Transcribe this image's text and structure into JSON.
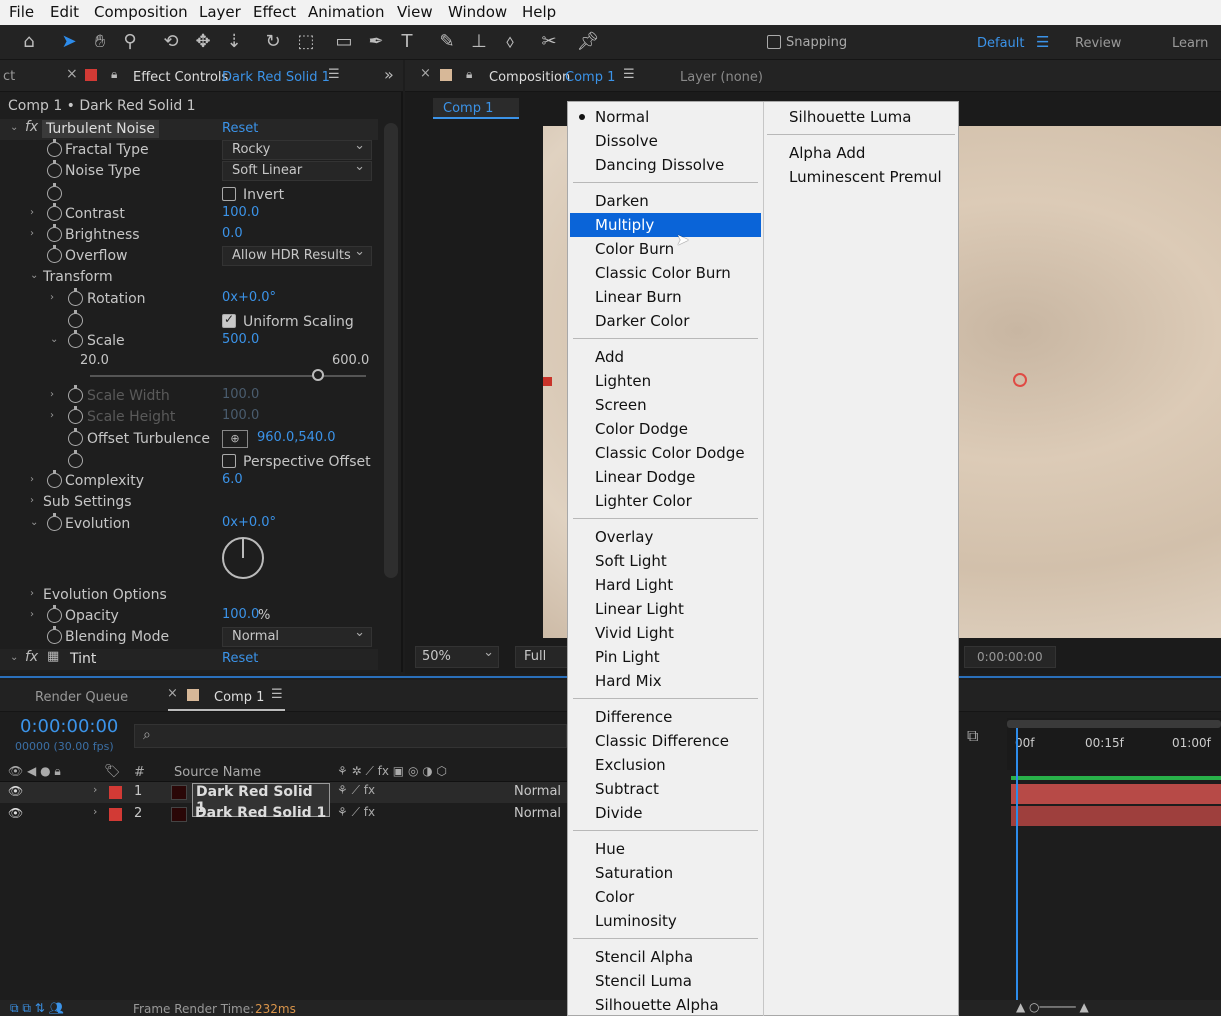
{
  "menubar": [
    "File",
    "Edit",
    "Composition",
    "Layer",
    "Effect",
    "Animation",
    "View",
    "Window",
    "Help"
  ],
  "toolbar": {
    "icons": [
      "home-icon",
      "selection-tool-icon",
      "hand-tool-icon",
      "zoom-tool-icon",
      "orbit-camera-icon",
      "pan-camera-icon",
      "dolly-camera-icon",
      "rotation-tool-icon",
      "pan-behind-icon",
      "rectangle-tool-icon",
      "pen-tool-icon",
      "type-tool-icon",
      "brush-tool-icon",
      "clone-stamp-icon",
      "eraser-icon",
      "roto-brush-icon",
      "puppet-pin-icon"
    ],
    "snapping_label": "Snapping",
    "workspaces": [
      "Default",
      "Review",
      "Learn"
    ]
  },
  "effect_panel": {
    "left_tab_fragment": "ct",
    "tab_label": "Effect Controls",
    "layer_name": "Dark Red Solid 1",
    "breadcrumb": "Comp 1 • Dark Red Solid 1",
    "effect_name": "Turbulent Noise",
    "reset_label": "Reset",
    "props": {
      "fractal_type": {
        "label": "Fractal Type",
        "value": "Rocky"
      },
      "noise_type": {
        "label": "Noise Type",
        "value": "Soft Linear"
      },
      "invert": {
        "label": "Invert"
      },
      "contrast": {
        "label": "Contrast",
        "value": "100.0"
      },
      "brightness": {
        "label": "Brightness",
        "value": "0.0"
      },
      "overflow": {
        "label": "Overflow",
        "value": "Allow HDR Results"
      },
      "transform": {
        "label": "Transform"
      },
      "rotation": {
        "label": "Rotation",
        "value": "0x+0.0°"
      },
      "uniform_scaling": {
        "label": "Uniform Scaling"
      },
      "scale": {
        "label": "Scale",
        "value": "500.0",
        "min": "20.0",
        "max": "600.0",
        "slider_fraction": 0.826
      },
      "scale_width": {
        "label": "Scale Width",
        "value": "100.0"
      },
      "scale_height": {
        "label": "Scale Height",
        "value": "100.0"
      },
      "offset_turbulence": {
        "label": "Offset Turbulence",
        "value": "960.0,540.0"
      },
      "perspective_offset": {
        "label": "Perspective Offset"
      },
      "complexity": {
        "label": "Complexity",
        "value": "6.0"
      },
      "sub_settings": {
        "label": "Sub Settings"
      },
      "evolution": {
        "label": "Evolution",
        "value": "0x+0.0°"
      },
      "evolution_options": {
        "label": "Evolution Options"
      },
      "opacity": {
        "label": "Opacity",
        "value": "100.0",
        "unit": "%"
      },
      "blending_mode": {
        "label": "Blending Mode",
        "value": "Normal"
      }
    },
    "tint_name": "Tint"
  },
  "comp_panel": {
    "tab_label": "Composition",
    "comp_name": "Comp 1",
    "layer_none": "Layer (none)",
    "sub_tab": "Comp 1",
    "zoom": "50%",
    "resolution": "Full",
    "timecode": "0:00:00:00"
  },
  "timeline": {
    "render_queue": "Render Queue",
    "comp_tab": "Comp 1",
    "timecode": "0:00:00:00",
    "frame_info": "00000 (30.00 fps)",
    "col_num": "#",
    "col_source": "Source Name",
    "layers": [
      {
        "num": "1",
        "name": "Dark Red Solid 1",
        "mode": "Normal"
      },
      {
        "num": "2",
        "name": "Dark Red Solid 1",
        "mode": "Normal"
      }
    ],
    "ruler": [
      "00f",
      "00:15f",
      "01:00f"
    ],
    "frame_render_label": "Frame Render Time:",
    "frame_render_value": "232ms"
  },
  "blend_menu": {
    "col1": [
      [
        "Normal",
        "Dissolve",
        "Dancing Dissolve"
      ],
      [
        "Darken",
        "Multiply",
        "Color Burn",
        "Classic Color Burn",
        "Linear Burn",
        "Darker Color"
      ],
      [
        "Add",
        "Lighten",
        "Screen",
        "Color Dodge",
        "Classic Color Dodge",
        "Linear Dodge",
        "Lighter Color"
      ],
      [
        "Overlay",
        "Soft Light",
        "Hard Light",
        "Linear Light",
        "Vivid Light",
        "Pin Light",
        "Hard Mix"
      ],
      [
        "Difference",
        "Classic Difference",
        "Exclusion",
        "Subtract",
        "Divide"
      ],
      [
        "Hue",
        "Saturation",
        "Color",
        "Luminosity"
      ],
      [
        "Stencil Alpha",
        "Stencil Luma",
        "Silhouette Alpha"
      ]
    ],
    "col2": [
      [
        "Silhouette Luma"
      ],
      [
        "Alpha Add",
        "Luminescent Premul"
      ]
    ],
    "checked": "Normal",
    "highlighted": "Multiply"
  },
  "colors": {
    "accent": "#2d8ceb",
    "highlight": "#0a64d8",
    "layer_red": "#c0392b",
    "canvas": "#d8c7b2"
  }
}
